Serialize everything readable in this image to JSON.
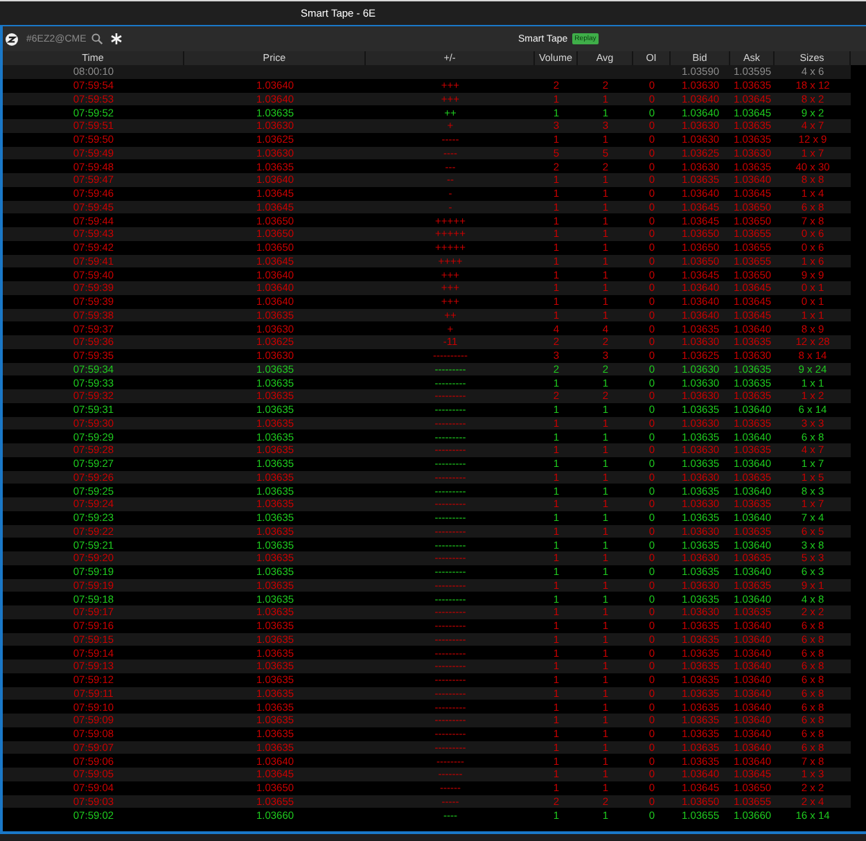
{
  "window": {
    "title": "Smart Tape - 6E"
  },
  "toolbar": {
    "symbol": "#6EZ2@CME",
    "title": "Smart Tape",
    "badge": "Replay"
  },
  "table": {
    "columns": [
      "Time",
      "Price",
      "+/-",
      "Volume",
      "Avg",
      "OI",
      "Bid",
      "Ask",
      "Sizes"
    ],
    "rows": [
      {
        "time": "08:00:10",
        "bid": "1.03590",
        "ask": "1.03595",
        "sizes": "4 x 6",
        "color": "#8c8c8c"
      },
      {
        "time": "07:59:54",
        "price": "1.03640",
        "plus_minus": "+++",
        "volume": "2",
        "avg": "2",
        "oi": "0",
        "bid": "1.03630",
        "ask": "1.03635",
        "sizes": "18 x 12",
        "color": "#cc0000"
      },
      {
        "time": "07:59:53",
        "price": "1.03640",
        "plus_minus": "+++",
        "volume": "1",
        "avg": "1",
        "oi": "0",
        "bid": "1.03640",
        "ask": "1.03645",
        "sizes": "8 x 2",
        "color": "#cc0000"
      },
      {
        "time": "07:59:52",
        "price": "1.03635",
        "plus_minus": "++",
        "volume": "1",
        "avg": "1",
        "oi": "0",
        "bid": "1.03640",
        "ask": "1.03645",
        "sizes": "9 x 2",
        "color": "#1fcc1f"
      },
      {
        "time": "07:59:51",
        "price": "1.03630",
        "plus_minus": "+",
        "volume": "3",
        "avg": "3",
        "oi": "0",
        "bid": "1.03630",
        "ask": "1.03635",
        "sizes": "4 x 7",
        "color": "#cc0000"
      },
      {
        "time": "07:59:50",
        "price": "1.03625",
        "plus_minus": "-----",
        "volume": "1",
        "avg": "1",
        "oi": "0",
        "bid": "1.03630",
        "ask": "1.03635",
        "sizes": "12 x 9",
        "color": "#cc0000"
      },
      {
        "time": "07:59:49",
        "price": "1.03630",
        "plus_minus": "----",
        "volume": "5",
        "avg": "5",
        "oi": "0",
        "bid": "1.03625",
        "ask": "1.03630",
        "sizes": "1 x 7",
        "color": "#cc0000"
      },
      {
        "time": "07:59:48",
        "price": "1.03635",
        "plus_minus": "---",
        "volume": "2",
        "avg": "2",
        "oi": "0",
        "bid": "1.03630",
        "ask": "1.03635",
        "sizes": "40 x 30",
        "color": "#cc0000"
      },
      {
        "time": "07:59:47",
        "price": "1.03640",
        "plus_minus": "--",
        "volume": "1",
        "avg": "1",
        "oi": "0",
        "bid": "1.03635",
        "ask": "1.03640",
        "sizes": "8 x 8",
        "color": "#cc0000"
      },
      {
        "time": "07:59:46",
        "price": "1.03645",
        "plus_minus": "-",
        "volume": "1",
        "avg": "1",
        "oi": "0",
        "bid": "1.03640",
        "ask": "1.03645",
        "sizes": "1 x 4",
        "color": "#cc0000"
      },
      {
        "time": "07:59:45",
        "price": "1.03645",
        "plus_minus": "-",
        "volume": "1",
        "avg": "1",
        "oi": "0",
        "bid": "1.03645",
        "ask": "1.03650",
        "sizes": "6 x 8",
        "color": "#cc0000"
      },
      {
        "time": "07:59:44",
        "price": "1.03650",
        "plus_minus": "+++++",
        "volume": "1",
        "avg": "1",
        "oi": "0",
        "bid": "1.03645",
        "ask": "1.03650",
        "sizes": "7 x 8",
        "color": "#cc0000"
      },
      {
        "time": "07:59:43",
        "price": "1.03650",
        "plus_minus": "+++++",
        "volume": "1",
        "avg": "1",
        "oi": "0",
        "bid": "1.03650",
        "ask": "1.03655",
        "sizes": "0 x 6",
        "color": "#cc0000"
      },
      {
        "time": "07:59:42",
        "price": "1.03650",
        "plus_minus": "+++++",
        "volume": "1",
        "avg": "1",
        "oi": "0",
        "bid": "1.03650",
        "ask": "1.03655",
        "sizes": "0 x 6",
        "color": "#cc0000"
      },
      {
        "time": "07:59:41",
        "price": "1.03645",
        "plus_minus": "++++",
        "volume": "1",
        "avg": "1",
        "oi": "0",
        "bid": "1.03650",
        "ask": "1.03655",
        "sizes": "1 x 6",
        "color": "#cc0000"
      },
      {
        "time": "07:59:40",
        "price": "1.03640",
        "plus_minus": "+++",
        "volume": "1",
        "avg": "1",
        "oi": "0",
        "bid": "1.03645",
        "ask": "1.03650",
        "sizes": "9 x 9",
        "color": "#cc0000"
      },
      {
        "time": "07:59:39",
        "price": "1.03640",
        "plus_minus": "+++",
        "volume": "1",
        "avg": "1",
        "oi": "0",
        "bid": "1.03640",
        "ask": "1.03645",
        "sizes": "0 x 1",
        "color": "#cc0000"
      },
      {
        "time": "07:59:39",
        "price": "1.03640",
        "plus_minus": "+++",
        "volume": "1",
        "avg": "1",
        "oi": "0",
        "bid": "1.03640",
        "ask": "1.03645",
        "sizes": "0 x 1",
        "color": "#cc0000"
      },
      {
        "time": "07:59:38",
        "price": "1.03635",
        "plus_minus": "++",
        "volume": "1",
        "avg": "1",
        "oi": "0",
        "bid": "1.03640",
        "ask": "1.03645",
        "sizes": "1 x 1",
        "color": "#cc0000"
      },
      {
        "time": "07:59:37",
        "price": "1.03630",
        "plus_minus": "+",
        "volume": "4",
        "avg": "4",
        "oi": "0",
        "bid": "1.03635",
        "ask": "1.03640",
        "sizes": "8 x 9",
        "color": "#cc0000"
      },
      {
        "time": "07:59:36",
        "price": "1.03625",
        "plus_minus": "-11",
        "volume": "2",
        "avg": "2",
        "oi": "0",
        "bid": "1.03630",
        "ask": "1.03635",
        "sizes": "12 x 28",
        "color": "#cc0000"
      },
      {
        "time": "07:59:35",
        "price": "1.03630",
        "plus_minus": "----------",
        "volume": "3",
        "avg": "3",
        "oi": "0",
        "bid": "1.03625",
        "ask": "1.03630",
        "sizes": "8 x 14",
        "color": "#cc0000"
      },
      {
        "time": "07:59:34",
        "price": "1.03635",
        "plus_minus": "---------",
        "volume": "2",
        "avg": "2",
        "oi": "0",
        "bid": "1.03630",
        "ask": "1.03635",
        "sizes": "9 x 24",
        "color": "#1fcc1f"
      },
      {
        "time": "07:59:33",
        "price": "1.03635",
        "plus_minus": "---------",
        "volume": "1",
        "avg": "1",
        "oi": "0",
        "bid": "1.03630",
        "ask": "1.03635",
        "sizes": "1 x 1",
        "color": "#1fcc1f"
      },
      {
        "time": "07:59:32",
        "price": "1.03635",
        "plus_minus": "---------",
        "volume": "2",
        "avg": "2",
        "oi": "0",
        "bid": "1.03630",
        "ask": "1.03635",
        "sizes": "1 x 2",
        "color": "#cc0000"
      },
      {
        "time": "07:59:31",
        "price": "1.03635",
        "plus_minus": "---------",
        "volume": "1",
        "avg": "1",
        "oi": "0",
        "bid": "1.03635",
        "ask": "1.03640",
        "sizes": "6 x 14",
        "color": "#1fcc1f"
      },
      {
        "time": "07:59:30",
        "price": "1.03635",
        "plus_minus": "---------",
        "volume": "1",
        "avg": "1",
        "oi": "0",
        "bid": "1.03630",
        "ask": "1.03635",
        "sizes": "3 x 3",
        "color": "#cc0000"
      },
      {
        "time": "07:59:29",
        "price": "1.03635",
        "plus_minus": "---------",
        "volume": "1",
        "avg": "1",
        "oi": "0",
        "bid": "1.03635",
        "ask": "1.03640",
        "sizes": "6 x 8",
        "color": "#1fcc1f"
      },
      {
        "time": "07:59:28",
        "price": "1.03635",
        "plus_minus": "---------",
        "volume": "1",
        "avg": "1",
        "oi": "0",
        "bid": "1.03630",
        "ask": "1.03635",
        "sizes": "4 x 7",
        "color": "#cc0000"
      },
      {
        "time": "07:59:27",
        "price": "1.03635",
        "plus_minus": "---------",
        "volume": "1",
        "avg": "1",
        "oi": "0",
        "bid": "1.03635",
        "ask": "1.03640",
        "sizes": "1 x 7",
        "color": "#1fcc1f"
      },
      {
        "time": "07:59:26",
        "price": "1.03635",
        "plus_minus": "---------",
        "volume": "1",
        "avg": "1",
        "oi": "0",
        "bid": "1.03630",
        "ask": "1.03635",
        "sizes": "1 x 5",
        "color": "#cc0000"
      },
      {
        "time": "07:59:25",
        "price": "1.03635",
        "plus_minus": "---------",
        "volume": "1",
        "avg": "1",
        "oi": "0",
        "bid": "1.03635",
        "ask": "1.03640",
        "sizes": "8 x 3",
        "color": "#1fcc1f"
      },
      {
        "time": "07:59:24",
        "price": "1.03635",
        "plus_minus": "---------",
        "volume": "1",
        "avg": "1",
        "oi": "0",
        "bid": "1.03630",
        "ask": "1.03635",
        "sizes": "1 x 7",
        "color": "#cc0000"
      },
      {
        "time": "07:59:23",
        "price": "1.03635",
        "plus_minus": "---------",
        "volume": "1",
        "avg": "1",
        "oi": "0",
        "bid": "1.03635",
        "ask": "1.03640",
        "sizes": "7 x 4",
        "color": "#1fcc1f"
      },
      {
        "time": "07:59:22",
        "price": "1.03635",
        "plus_minus": "---------",
        "volume": "1",
        "avg": "1",
        "oi": "0",
        "bid": "1.03630",
        "ask": "1.03635",
        "sizes": "6 x 5",
        "color": "#cc0000"
      },
      {
        "time": "07:59:21",
        "price": "1.03635",
        "plus_minus": "---------",
        "volume": "1",
        "avg": "1",
        "oi": "0",
        "bid": "1.03635",
        "ask": "1.03640",
        "sizes": "3 x 8",
        "color": "#1fcc1f"
      },
      {
        "time": "07:59:20",
        "price": "1.03635",
        "plus_minus": "---------",
        "volume": "1",
        "avg": "1",
        "oi": "0",
        "bid": "1.03630",
        "ask": "1.03635",
        "sizes": "5 x 3",
        "color": "#cc0000"
      },
      {
        "time": "07:59:19",
        "price": "1.03635",
        "plus_minus": "---------",
        "volume": "1",
        "avg": "1",
        "oi": "0",
        "bid": "1.03635",
        "ask": "1.03640",
        "sizes": "6 x 3",
        "color": "#1fcc1f"
      },
      {
        "time": "07:59:19",
        "price": "1.03635",
        "plus_minus": "---------",
        "volume": "1",
        "avg": "1",
        "oi": "0",
        "bid": "1.03630",
        "ask": "1.03635",
        "sizes": "9 x 1",
        "color": "#cc0000"
      },
      {
        "time": "07:59:18",
        "price": "1.03635",
        "plus_minus": "---------",
        "volume": "1",
        "avg": "1",
        "oi": "0",
        "bid": "1.03635",
        "ask": "1.03640",
        "sizes": "4 x 8",
        "color": "#1fcc1f"
      },
      {
        "time": "07:59:17",
        "price": "1.03635",
        "plus_minus": "---------",
        "volume": "1",
        "avg": "1",
        "oi": "0",
        "bid": "1.03630",
        "ask": "1.03635",
        "sizes": "2 x 2",
        "color": "#cc0000"
      },
      {
        "time": "07:59:16",
        "price": "1.03635",
        "plus_minus": "---------",
        "volume": "1",
        "avg": "1",
        "oi": "0",
        "bid": "1.03635",
        "ask": "1.03640",
        "sizes": "6 x 8",
        "color": "#cc0000"
      },
      {
        "time": "07:59:15",
        "price": "1.03635",
        "plus_minus": "---------",
        "volume": "1",
        "avg": "1",
        "oi": "0",
        "bid": "1.03635",
        "ask": "1.03640",
        "sizes": "6 x 8",
        "color": "#cc0000"
      },
      {
        "time": "07:59:14",
        "price": "1.03635",
        "plus_minus": "---------",
        "volume": "1",
        "avg": "1",
        "oi": "0",
        "bid": "1.03635",
        "ask": "1.03640",
        "sizes": "6 x 8",
        "color": "#cc0000"
      },
      {
        "time": "07:59:13",
        "price": "1.03635",
        "plus_minus": "---------",
        "volume": "1",
        "avg": "1",
        "oi": "0",
        "bid": "1.03635",
        "ask": "1.03640",
        "sizes": "6 x 8",
        "color": "#cc0000"
      },
      {
        "time": "07:59:12",
        "price": "1.03635",
        "plus_minus": "---------",
        "volume": "1",
        "avg": "1",
        "oi": "0",
        "bid": "1.03635",
        "ask": "1.03640",
        "sizes": "6 x 8",
        "color": "#cc0000"
      },
      {
        "time": "07:59:11",
        "price": "1.03635",
        "plus_minus": "---------",
        "volume": "1",
        "avg": "1",
        "oi": "0",
        "bid": "1.03635",
        "ask": "1.03640",
        "sizes": "6 x 8",
        "color": "#cc0000"
      },
      {
        "time": "07:59:10",
        "price": "1.03635",
        "plus_minus": "---------",
        "volume": "1",
        "avg": "1",
        "oi": "0",
        "bid": "1.03635",
        "ask": "1.03640",
        "sizes": "6 x 8",
        "color": "#cc0000"
      },
      {
        "time": "07:59:09",
        "price": "1.03635",
        "plus_minus": "---------",
        "volume": "1",
        "avg": "1",
        "oi": "0",
        "bid": "1.03635",
        "ask": "1.03640",
        "sizes": "6 x 8",
        "color": "#cc0000"
      },
      {
        "time": "07:59:08",
        "price": "1.03635",
        "plus_minus": "---------",
        "volume": "1",
        "avg": "1",
        "oi": "0",
        "bid": "1.03635",
        "ask": "1.03640",
        "sizes": "6 x 8",
        "color": "#cc0000"
      },
      {
        "time": "07:59:07",
        "price": "1.03635",
        "plus_minus": "---------",
        "volume": "1",
        "avg": "1",
        "oi": "0",
        "bid": "1.03635",
        "ask": "1.03640",
        "sizes": "6 x 8",
        "color": "#cc0000"
      },
      {
        "time": "07:59:06",
        "price": "1.03640",
        "plus_minus": "--------",
        "volume": "1",
        "avg": "1",
        "oi": "0",
        "bid": "1.03635",
        "ask": "1.03640",
        "sizes": "7 x 8",
        "color": "#cc0000"
      },
      {
        "time": "07:59:05",
        "price": "1.03645",
        "plus_minus": "-------",
        "volume": "1",
        "avg": "1",
        "oi": "0",
        "bid": "1.03640",
        "ask": "1.03645",
        "sizes": "1 x 3",
        "color": "#cc0000"
      },
      {
        "time": "07:59:04",
        "price": "1.03650",
        "plus_minus": "------",
        "volume": "1",
        "avg": "1",
        "oi": "0",
        "bid": "1.03645",
        "ask": "1.03650",
        "sizes": "2 x 2",
        "color": "#cc0000"
      },
      {
        "time": "07:59:03",
        "price": "1.03655",
        "plus_minus": "-----",
        "volume": "2",
        "avg": "2",
        "oi": "0",
        "bid": "1.03650",
        "ask": "1.03655",
        "sizes": "2 x 4",
        "color": "#cc0000"
      },
      {
        "time": "07:59:02",
        "price": "1.03660",
        "plus_minus": "----",
        "volume": "1",
        "avg": "1",
        "oi": "0",
        "bid": "1.03655",
        "ask": "1.03660",
        "sizes": "16 x 14",
        "color": "#1fcc1f"
      }
    ]
  }
}
